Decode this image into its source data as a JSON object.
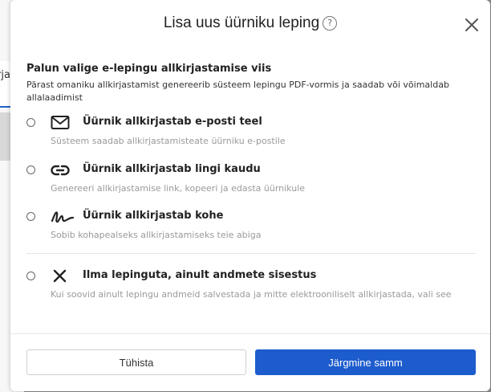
{
  "background": {
    "tab_label": "rja"
  },
  "modal": {
    "title": "Lisa uus üürniku leping",
    "help_glyph": "?",
    "section_title": "Palun valige e-lepingu allkirjastamise viis",
    "section_desc": "Pärast omaniku allkirjastamist genereerib süsteem lepingu PDF-vormis ja saadab või võimaldab allalaadimist",
    "options": [
      {
        "label": "Üürnik allkirjastab e-posti teel",
        "desc": "Süsteem saadab allkirjastamisteate üürniku e-postile",
        "icon": "envelope-icon"
      },
      {
        "label": "Üürnik allkirjastab lingi kaudu",
        "desc": "Genereeri allkirjastamise link, kopeeri ja edasta üürnikule",
        "icon": "link-icon"
      },
      {
        "label": "Üürnik allkirjastab kohe",
        "desc": "Sobib kohapealseks allkirjastamiseks teie abiga",
        "icon": "signature-icon"
      },
      {
        "label": "Ilma lepinguta, ainult andmete sisestus",
        "desc": "Kui soovid ainult lepingu andmeid salvestada ja mitte elektrooniliselt allkirjastada, vali see",
        "icon": "x-icon"
      }
    ],
    "cancel_label": "Tühista",
    "next_label": "Järgmine samm"
  },
  "colors": {
    "primary": "#1d5ccd",
    "muted_text": "#9a9a9a"
  }
}
